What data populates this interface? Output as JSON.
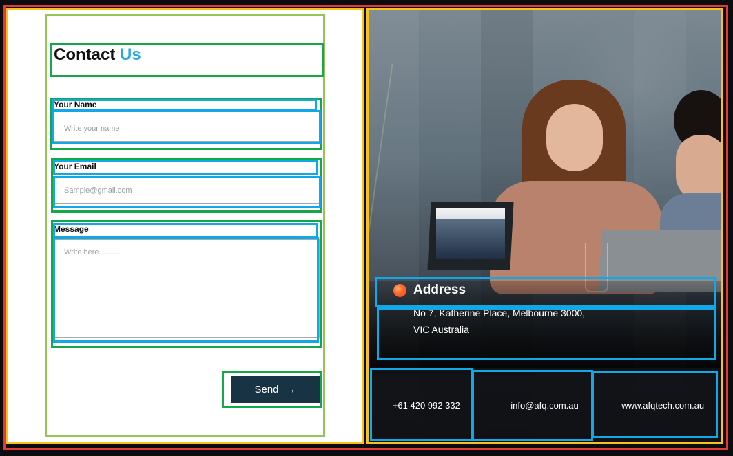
{
  "form": {
    "title_main": "Contact",
    "title_accent": "Us",
    "name_label": "Your Name",
    "name_placeholder": "Write your name",
    "email_label": "Your Email",
    "email_placeholder": "Sample@gmail.com",
    "message_label": "Message",
    "message_placeholder": "Write here..........",
    "send_label": "Send",
    "send_icon": "→"
  },
  "info": {
    "address_title": "Address",
    "address_line1": "No 7, Katherine Place, Melbourne 3000,",
    "address_line2": "VIC Australia",
    "phone": "+61 420 992 332",
    "email": "info@afq.com.au",
    "website": "www.afqtech.com.au"
  }
}
